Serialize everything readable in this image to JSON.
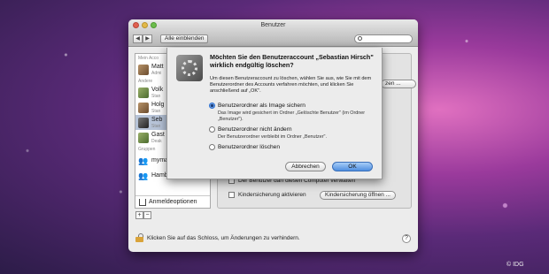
{
  "window": {
    "title": "Benutzer",
    "nav_back": "◀",
    "nav_forward": "▶",
    "show_all": "Alle einblenden"
  },
  "sidebar": {
    "section_my": "Mein Acco",
    "section_other": "Andere",
    "section_groups": "Gruppen",
    "items": [
      {
        "name": "Matt",
        "role": "Admi"
      },
      {
        "name": "Volk",
        "role": "Stan"
      },
      {
        "name": "Holg",
        "role": "Stan"
      },
      {
        "name": "Seb",
        "role": "Stan"
      },
      {
        "name": "Gast",
        "role": "Deak"
      },
      {
        "name": "mymac",
        "role": ""
      },
      {
        "name": "Hamburg",
        "role": ""
      }
    ],
    "login_options": "Anmeldeoptionen",
    "add": "+",
    "remove": "−"
  },
  "pane": {
    "right_button": "zen ...",
    "admin_checkbox": "Der Benutzer darf diesen Computer verwalten",
    "parental_checkbox": "Kindersicherung aktivieren",
    "parental_button": "Kindersicherung öffnen ..."
  },
  "footer": {
    "lock_text": "Klicken Sie auf das Schloss, um Änderungen zu verhindern.",
    "help": "?"
  },
  "dialog": {
    "title": "Möchten Sie den Benutzeraccount „Sebastian Hirsch\" wirklich endgültig löschen?",
    "description": "Um diesen Benutzeraccount zu löschen, wählen Sie aus, wie Sie mit dem Benutzerordner des Accounts verfahren möchten, und klicken Sie anschließend auf „OK\".",
    "options": [
      {
        "label": "Benutzerordner als Image sichern",
        "desc": "Das Image wird gesichert im Ordner „Gelöschte Benutzer\" (im Ordner „Benutzer\").",
        "selected": true
      },
      {
        "label": "Benutzerordner nicht ändern",
        "desc": "Der Benutzerordner verbleibt im Ordner „Benutzer\".",
        "selected": false
      },
      {
        "label": "Benutzerordner löschen",
        "desc": "",
        "selected": false
      }
    ],
    "cancel": "Abbrechen",
    "ok": "OK"
  },
  "credit": "© IDG"
}
